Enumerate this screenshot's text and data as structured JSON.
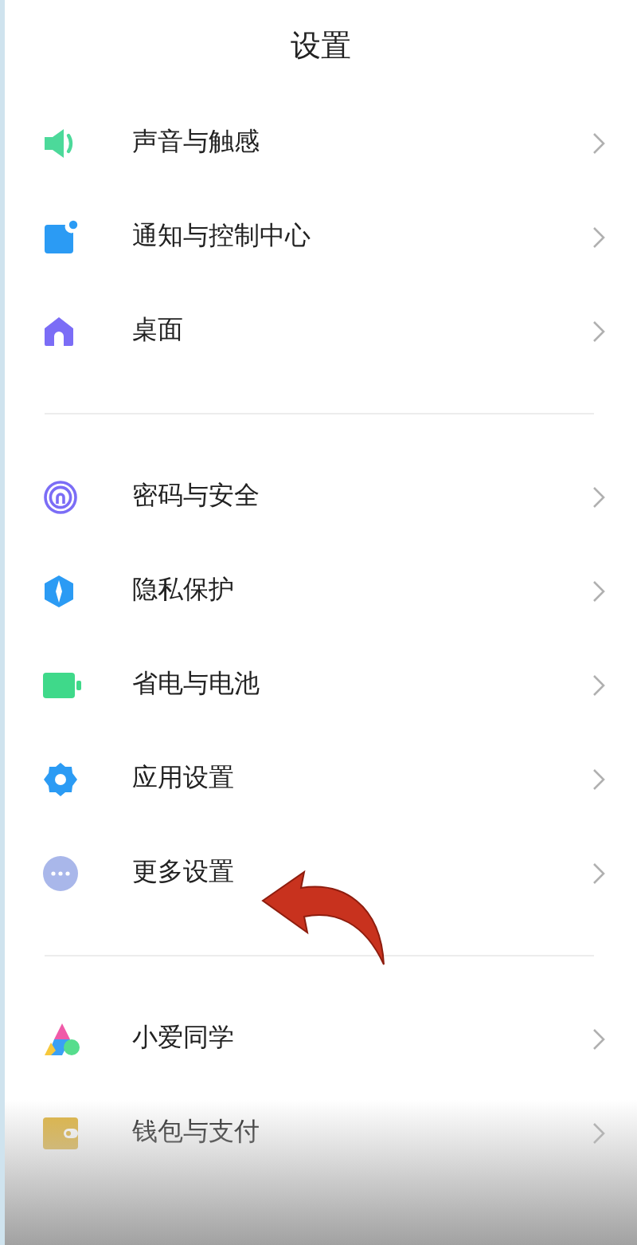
{
  "title": "设置",
  "groups": [
    {
      "items": [
        {
          "label": "声音与触感",
          "kind": "sound"
        },
        {
          "label": "通知与控制中心",
          "kind": "notification"
        },
        {
          "label": "桌面",
          "kind": "home"
        }
      ]
    },
    {
      "items": [
        {
          "label": "密码与安全",
          "kind": "fingerprint"
        },
        {
          "label": "隐私保护",
          "kind": "privacy"
        },
        {
          "label": "省电与电池",
          "kind": "battery"
        },
        {
          "label": "应用设置",
          "kind": "gear"
        },
        {
          "label": "更多设置",
          "kind": "more"
        }
      ]
    },
    {
      "items": [
        {
          "label": "小爱同学",
          "kind": "assistant"
        },
        {
          "label": "钱包与支付",
          "kind": "wallet"
        }
      ]
    }
  ]
}
